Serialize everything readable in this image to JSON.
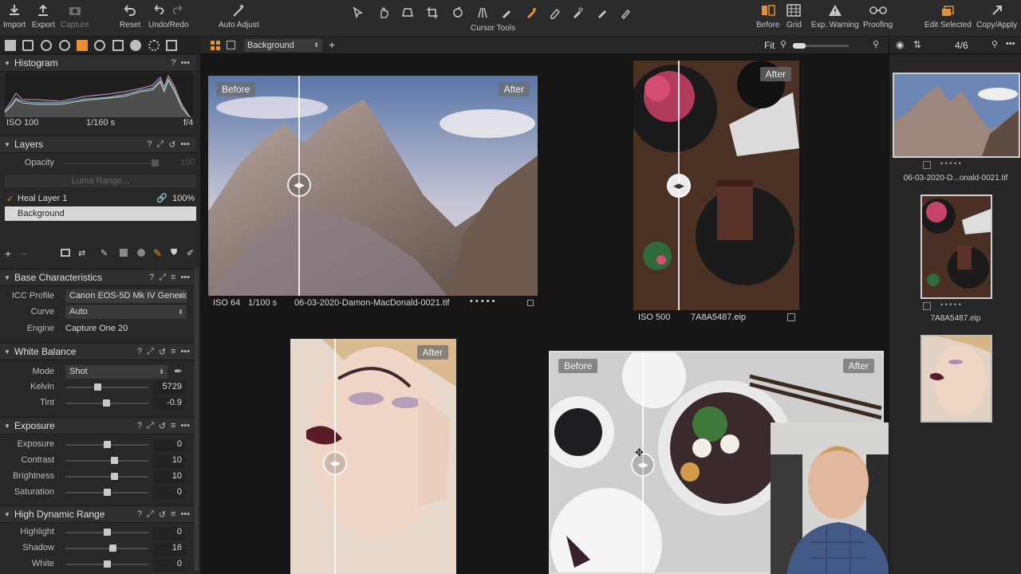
{
  "toolbar": {
    "import": "Import",
    "export": "Export",
    "capture": "Capture",
    "reset": "Reset",
    "undo_redo": "Undo/Redo",
    "auto_adjust": "Auto Adjust",
    "cursor_tools": "Cursor Tools",
    "before": "Before",
    "grid": "Grid",
    "exp_warning": "Exp. Warning",
    "proofing": "Proofing",
    "edit_selected": "Edit Selected",
    "copy_apply": "Copy/Apply",
    "accent_color": "#e8902d"
  },
  "view_bar": {
    "variant_select": "Background",
    "zoom_label": "Fit",
    "counter": "4/6"
  },
  "histogram": {
    "title": "Histogram",
    "iso": "ISO 100",
    "shutter": "1/160 s",
    "aperture": "f/4"
  },
  "layers": {
    "title": "Layers",
    "opacity_label": "Opacity",
    "opacity_value": "100",
    "luma_range": "Luma Range...",
    "items": [
      {
        "name": "Heal Layer 1",
        "opacity": "100%"
      },
      {
        "name": "Background"
      }
    ]
  },
  "base_characteristics": {
    "title": "Base Characteristics",
    "icc_label": "ICC Profile",
    "icc_value": "Canon EOS-5D Mk IV Generic",
    "curve_label": "Curve",
    "curve_value": "Auto",
    "engine_label": "Engine",
    "engine_value": "Capture One 20"
  },
  "white_balance": {
    "title": "White Balance",
    "mode_label": "Mode",
    "mode_value": "Shot",
    "kelvin_label": "Kelvin",
    "kelvin_value": "5729",
    "kelvin_pos": 0.38,
    "tint_label": "Tint",
    "tint_value": "-0.9",
    "tint_pos": 0.49
  },
  "exposure": {
    "title": "Exposure",
    "rows": [
      {
        "label": "Exposure",
        "value": "0",
        "pos": 0.5
      },
      {
        "label": "Contrast",
        "value": "10",
        "pos": 0.59
      },
      {
        "label": "Brightness",
        "value": "10",
        "pos": 0.59
      },
      {
        "label": "Saturation",
        "value": "0",
        "pos": 0.5
      }
    ]
  },
  "hdr": {
    "title": "High Dynamic Range",
    "rows": [
      {
        "label": "Highlight",
        "value": "0",
        "pos": 0.5
      },
      {
        "label": "Shadow",
        "value": "16",
        "pos": 0.57
      },
      {
        "label": "White",
        "value": "0",
        "pos": 0.5
      }
    ]
  },
  "viewer": {
    "before_tag": "Before",
    "after_tag": "After",
    "mountain_iso": "ISO 64",
    "mountain_shutter": "1/100 s",
    "mountain_file": "06-03-2020-Damon-MacDonald-0021.tif",
    "food_iso": "ISO 500",
    "food_file": "7A8A5487.eip"
  },
  "browser": {
    "thumb1_name": "06-03-2020-D...onald-0021.tif",
    "thumb2_name": "7A8A5487.eip"
  }
}
